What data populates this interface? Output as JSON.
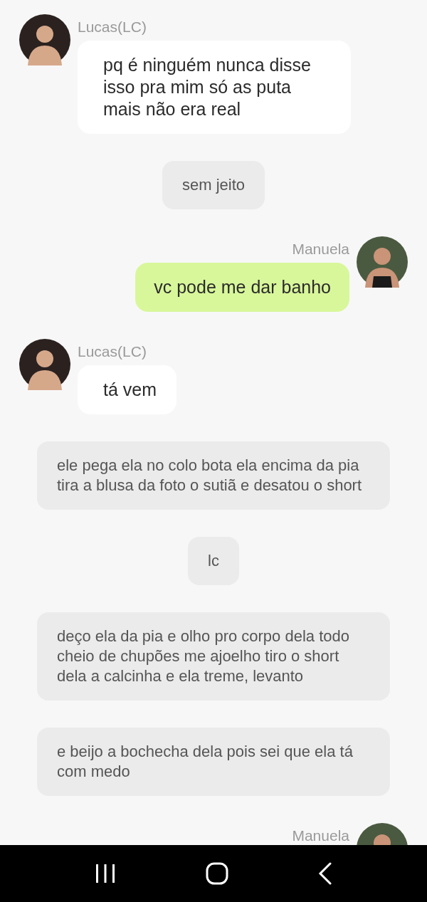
{
  "messages": [
    {
      "kind": "incoming",
      "sender": "Lucas(LC)",
      "text": "pq é ninguém nunca disse isso pra mim só as puta mais não era real"
    },
    {
      "kind": "narration",
      "text": "sem jeito"
    },
    {
      "kind": "outgoing",
      "sender": "Manuela",
      "text": "vc pode me dar banho"
    },
    {
      "kind": "incoming",
      "sender": "Lucas(LC)",
      "text": "tá vem"
    },
    {
      "kind": "narration",
      "text": "ele pega ela no colo bota ela encima da pia tira a blusa da foto o sutiã e desatou o short"
    },
    {
      "kind": "narration",
      "text": "lc"
    },
    {
      "kind": "narration",
      "text": "deço ela da pia e olho pro corpo dela todo cheio de chupões me ajoelho tiro o short dela a calcinha e ela treme, levanto"
    },
    {
      "kind": "narration",
      "text": "e beijo a bochecha dela pois sei que ela tá com medo"
    },
    {
      "kind": "outgoing",
      "sender": "Manuela"
    }
  ]
}
